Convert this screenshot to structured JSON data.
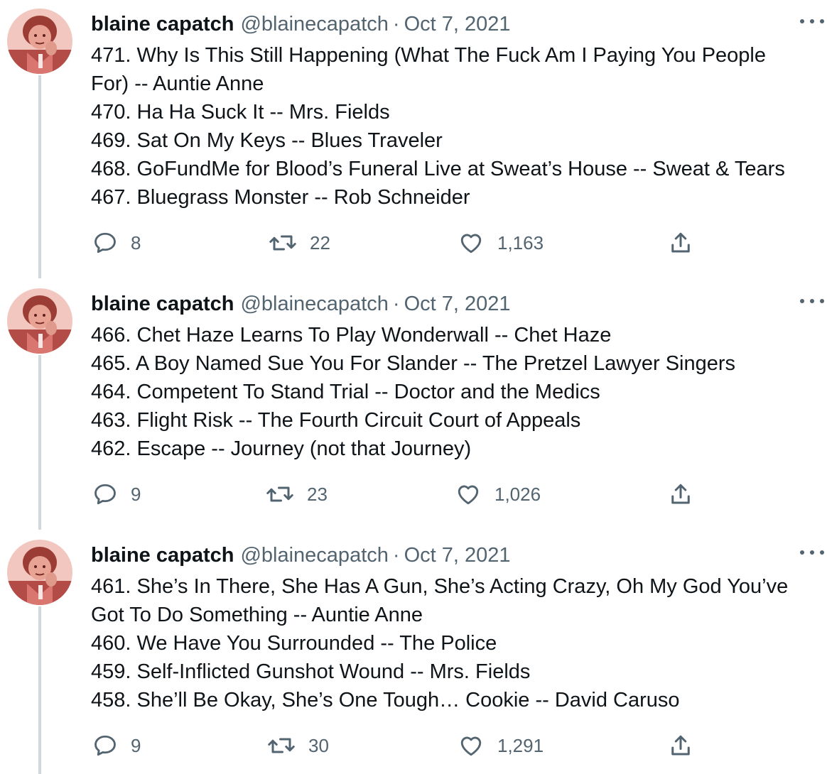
{
  "tweets": [
    {
      "author_name": "blaine capatch",
      "author_handle": "@blainecapatch",
      "separator": "·",
      "date": "Oct 7, 2021",
      "lines": [
        "471. Why Is This Still Happening (What The Fuck Am I Paying You People",
        "For) -- Auntie Anne",
        "470. Ha Ha Suck It -- Mrs. Fields",
        "469. Sat On My Keys -- Blues Traveler",
        "468. GoFundMe for Blood’s Funeral Live at Sweat’s House -- Sweat & Tears",
        "467. Bluegrass Monster -- Rob Schneider"
      ],
      "replies": "8",
      "retweets": "22",
      "likes": "1,163"
    },
    {
      "author_name": "blaine capatch",
      "author_handle": "@blainecapatch",
      "separator": "·",
      "date": "Oct 7, 2021",
      "lines": [
        "466. Chet Haze Learns To Play Wonderwall -- Chet Haze",
        "465. A Boy Named Sue You For Slander -- The Pretzel Lawyer Singers",
        "464. Competent To Stand Trial -- Doctor and the Medics",
        "463. Flight Risk -- The Fourth Circuit Court of Appeals",
        "462. Escape -- Journey (not that Journey)"
      ],
      "replies": "9",
      "retweets": "23",
      "likes": "1,026"
    },
    {
      "author_name": "blaine capatch",
      "author_handle": "@blainecapatch",
      "separator": "·",
      "date": "Oct 7, 2021",
      "lines": [
        "461. She’s In There, She Has A Gun, She’s Acting Crazy, Oh My God You’ve",
        "Got To Do Something -- Auntie Anne",
        "460. We Have You Surrounded -- The Police",
        "459. Self-Inflicted Gunshot Wound -- Mrs. Fields",
        "458. She’ll Be Okay, She’s One Tough… Cookie -- David Caruso"
      ],
      "replies": "9",
      "retweets": "30",
      "likes": "1,291"
    }
  ],
  "icons": {
    "reply": "reply-icon",
    "retweet": "retweet-icon",
    "like": "heart-icon",
    "share": "share-icon",
    "more": "more-options-icon"
  },
  "colors": {
    "text": "#0f1419",
    "secondary": "#536471",
    "thread_line": "#cfd9de",
    "avatar_tint": "#c96a64"
  }
}
